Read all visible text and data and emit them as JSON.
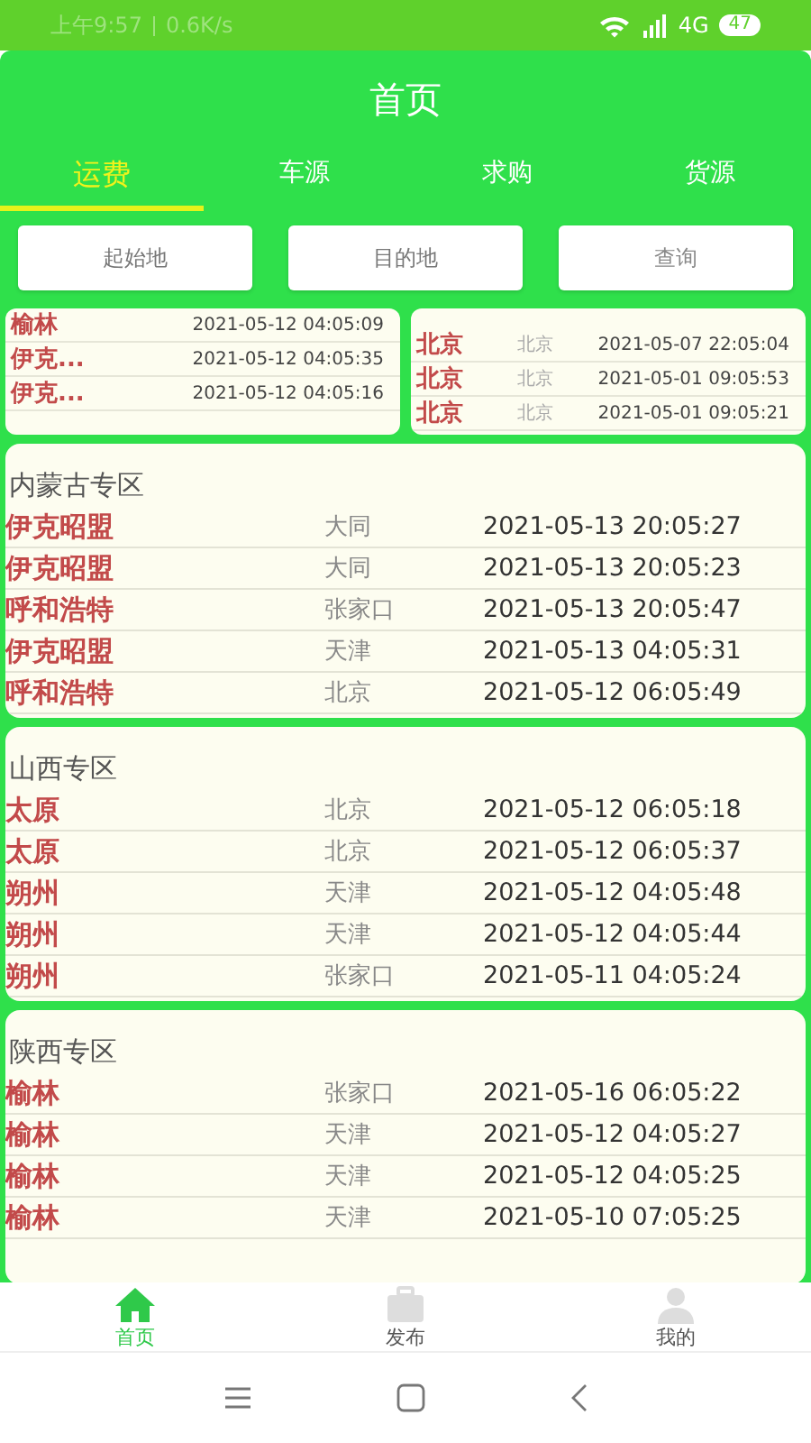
{
  "status_bar": {
    "time": "上午9:57",
    "speed": "0.6K/s",
    "network": "4G",
    "battery": "47"
  },
  "title": "首页",
  "tabs": [
    {
      "label": "运费",
      "selected": true
    },
    {
      "label": "车源",
      "selected": false
    },
    {
      "label": "求购",
      "selected": false
    },
    {
      "label": "货源",
      "selected": false
    }
  ],
  "filters": [
    {
      "kind": "field",
      "placeholder": "起始地"
    },
    {
      "kind": "field",
      "placeholder": "目的地"
    },
    {
      "kind": "button",
      "label": "查询"
    }
  ],
  "quick_lists": [
    {
      "rows": [
        {
          "name": "榆林",
          "time": "2021-05-12 04:05:09"
        },
        {
          "name": "伊克...",
          "time": "2021-05-12 04:05:35"
        },
        {
          "name": "伊克...",
          "time": "2021-05-12 04:05:16"
        }
      ]
    },
    {
      "rows": [
        {
          "name": "北京",
          "city": "北京",
          "time": "2021-05-07 22:05:04"
        },
        {
          "name": "北京",
          "city": "北京",
          "time": "2021-05-01 09:05:53"
        },
        {
          "name": "北京",
          "city": "北京",
          "time": "2021-05-01 09:05:21"
        }
      ]
    }
  ],
  "sections": [
    {
      "title": "内蒙古专区",
      "rows": [
        {
          "name": "伊克昭盟",
          "city": "大同",
          "time": "2021-05-13 20:05:27"
        },
        {
          "name": "伊克昭盟",
          "city": "大同",
          "time": "2021-05-13 20:05:23"
        },
        {
          "name": "呼和浩特",
          "city": "张家口",
          "time": "2021-05-13 20:05:47"
        },
        {
          "name": "伊克昭盟",
          "city": "天津",
          "time": "2021-05-13 04:05:31"
        },
        {
          "name": "呼和浩特",
          "city": "北京",
          "time": "2021-05-12 06:05:49"
        }
      ]
    },
    {
      "title": "山西专区",
      "rows": [
        {
          "name": "太原",
          "city": "北京",
          "time": "2021-05-12 06:05:18"
        },
        {
          "name": "太原",
          "city": "北京",
          "time": "2021-05-12 06:05:37"
        },
        {
          "name": "朔州",
          "city": "天津",
          "time": "2021-05-12 04:05:48"
        },
        {
          "name": "朔州",
          "city": "天津",
          "time": "2021-05-12 04:05:44"
        },
        {
          "name": "朔州",
          "city": "张家口",
          "time": "2021-05-11 04:05:24"
        }
      ]
    },
    {
      "title": "陕西专区",
      "rows": [
        {
          "name": "榆林",
          "city": "张家口",
          "time": "2021-05-16 06:05:22"
        },
        {
          "name": "榆林",
          "city": "天津",
          "time": "2021-05-12 04:05:27"
        },
        {
          "name": "榆林",
          "city": "天津",
          "time": "2021-05-12 04:05:25"
        },
        {
          "name": "榆林",
          "city": "天津",
          "time": "2021-05-10 07:05:25"
        }
      ]
    }
  ],
  "bottom_nav": [
    {
      "label": "首页",
      "selected": true
    },
    {
      "label": "发布",
      "selected": false
    },
    {
      "label": "我的",
      "selected": false
    }
  ]
}
